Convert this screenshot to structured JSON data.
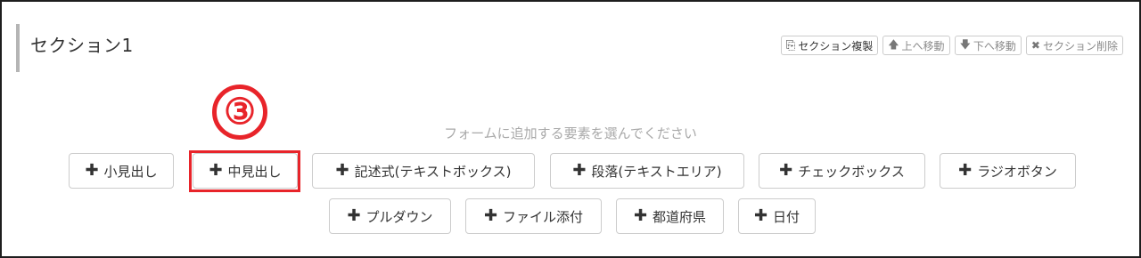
{
  "section": {
    "title": "セクション1"
  },
  "toolbar": {
    "duplicate_label": "セクション複製",
    "move_up_label": "上へ移動",
    "move_down_label": "下へ移動",
    "delete_label": "セクション削除"
  },
  "annotation": {
    "step_number": "③",
    "highlighted_button": "中見出し",
    "color": "#e8242a"
  },
  "form_builder": {
    "hint": "フォームに追加する要素を選んでください",
    "buttons": [
      {
        "label": "小見出し"
      },
      {
        "label": "中見出し"
      },
      {
        "label": "記述式(テキストボックス)"
      },
      {
        "label": "段落(テキストエリア)"
      },
      {
        "label": "チェックボックス"
      },
      {
        "label": "ラジオボタン"
      },
      {
        "label": "プルダウン"
      },
      {
        "label": "ファイル添付"
      },
      {
        "label": "都道府県"
      },
      {
        "label": "日付"
      }
    ]
  },
  "icons": {
    "plus": "plus-icon",
    "copy": "copy-icon",
    "arrow_up": "arrow-up-icon",
    "arrow_down": "arrow-down-icon",
    "close": "close-icon"
  }
}
